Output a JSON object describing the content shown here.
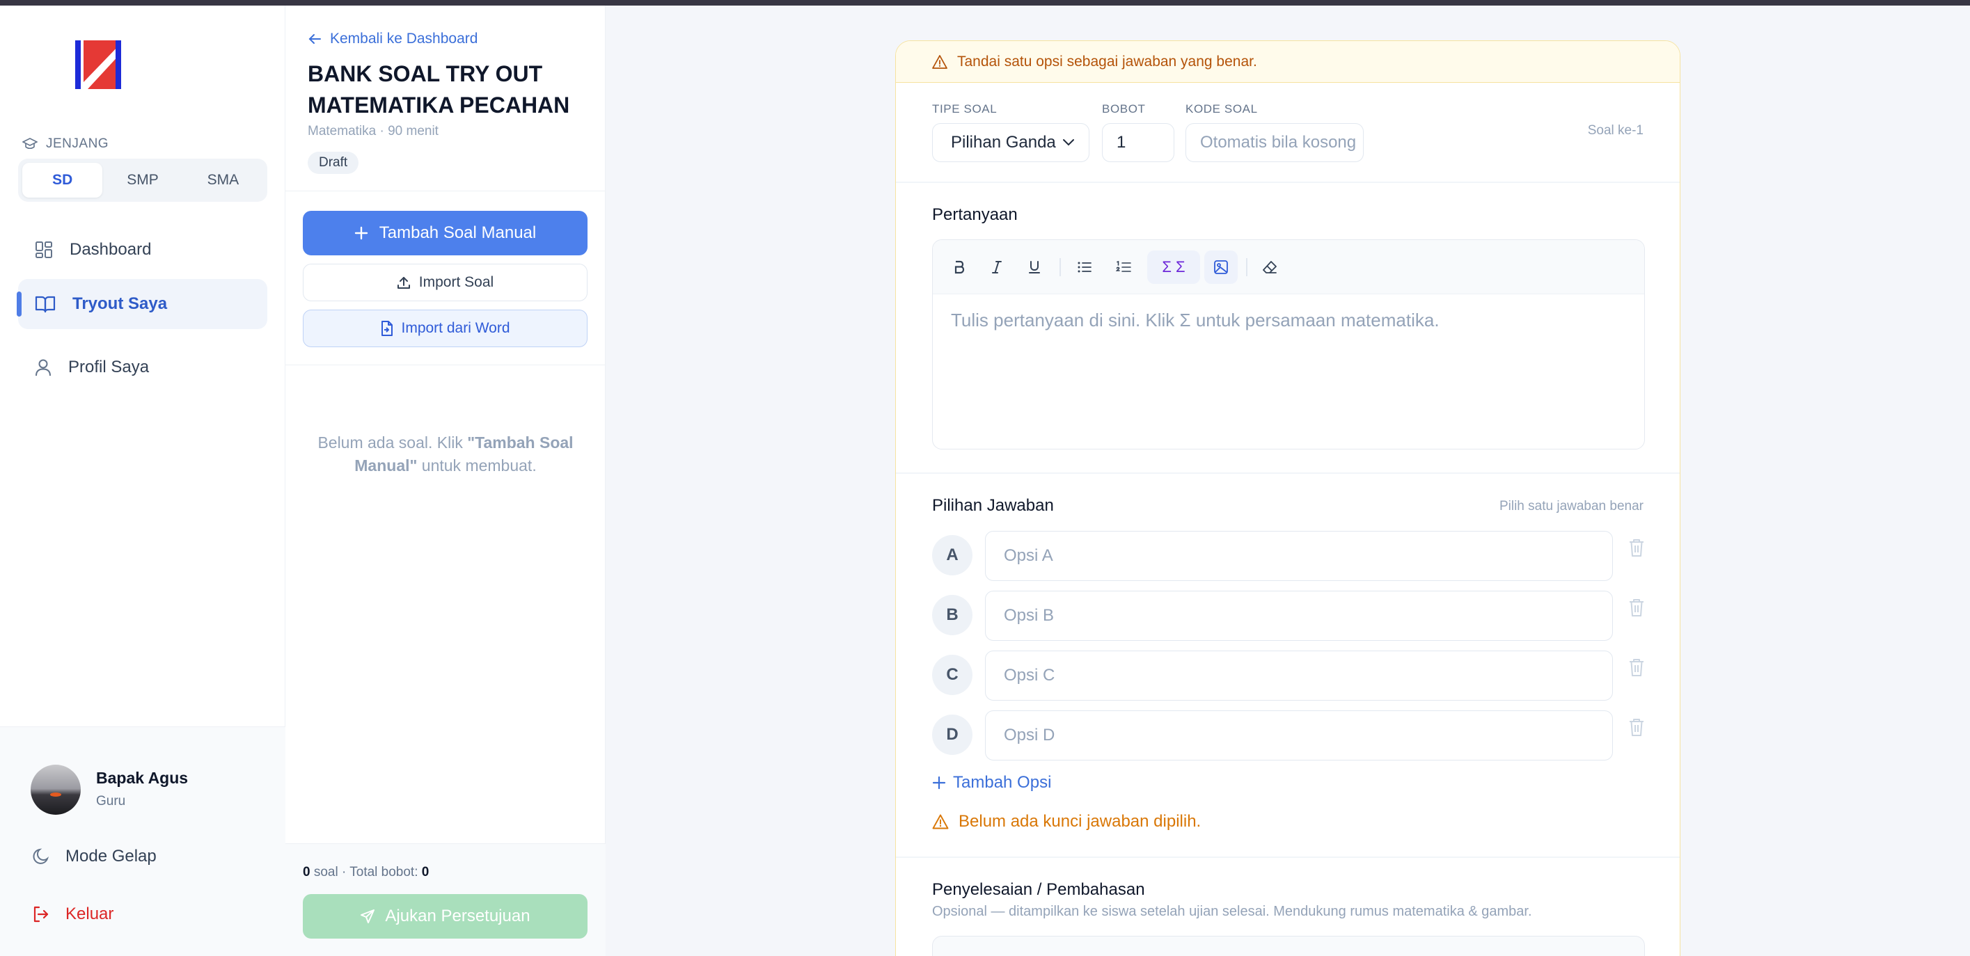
{
  "sidebar": {
    "jenjang_label": "JENJANG",
    "levels": [
      "SD",
      "SMP",
      "SMA"
    ],
    "active_level": "SD",
    "nav": [
      {
        "label": "Dashboard",
        "icon": "grid-icon"
      },
      {
        "label": "Tryout Saya",
        "icon": "book-open-icon",
        "active": true
      },
      {
        "label": "Profil Saya",
        "icon": "user-icon"
      }
    ],
    "user": {
      "name": "Bapak Agus",
      "role": "Guru"
    },
    "dark_mode_label": "Mode Gelap",
    "logout_label": "Keluar"
  },
  "panel": {
    "back_label": "Kembali ke Dashboard",
    "title": "BANK SOAL TRY OUT MATEMATIKA PECAHAN",
    "meta": "Matematika · 90 menit",
    "status": "Draft",
    "add_manual_label": "Tambah Soal Manual",
    "import_label": "Import Soal",
    "import_word_label": "Import dari Word",
    "empty_prefix": "Belum ada soal. Klik ",
    "empty_bold": "\"Tambah Soal Manual\"",
    "empty_suffix": " untuk membuat.",
    "count": "0",
    "count_label": " soal · Total bobot: ",
    "total_weight": "0",
    "submit_label": "Ajukan Persetujuan"
  },
  "editor": {
    "alert": "Tandai satu opsi sebagai jawaban yang benar.",
    "type_label": "TIPE SOAL",
    "type_value": "Pilihan Ganda",
    "weight_label": "BOBOT",
    "weight_value": "1",
    "code_label": "KODE SOAL",
    "code_placeholder": "Otomatis bila kosong",
    "question_index": "Soal ke-1",
    "question_title": "Pertanyaan",
    "question_placeholder": "Tulis pertanyaan di sini. Klik Σ untuk persamaan matematika.",
    "toolbar": [
      "bold-icon",
      "italic-icon",
      "underline-icon",
      "bullet-list-icon",
      "numbered-list-icon",
      "math-sigma-icon",
      "image-icon",
      "eraser-icon"
    ],
    "math_label": "Σ Σ",
    "answers_title": "Pilihan Jawaban",
    "answers_hint": "Pilih satu jawaban benar",
    "options": [
      {
        "letter": "A",
        "placeholder": "Opsi A"
      },
      {
        "letter": "B",
        "placeholder": "Opsi B"
      },
      {
        "letter": "C",
        "placeholder": "Opsi C"
      },
      {
        "letter": "D",
        "placeholder": "Opsi D"
      }
    ],
    "add_option_label": "Tambah Opsi",
    "no_key_warning": "Belum ada kunci jawaban dipilih.",
    "solution_title": "Penyelesaian / Pembahasan",
    "solution_subtitle": "Opsional — ditampilkan ke siswa setelah ujian selesai. Mendukung rumus matematika & gambar."
  },
  "colors": {
    "primary": "#4d80ec",
    "danger": "#dc2626",
    "warning": "#d97706",
    "success_disabled": "#a9dfbc"
  }
}
